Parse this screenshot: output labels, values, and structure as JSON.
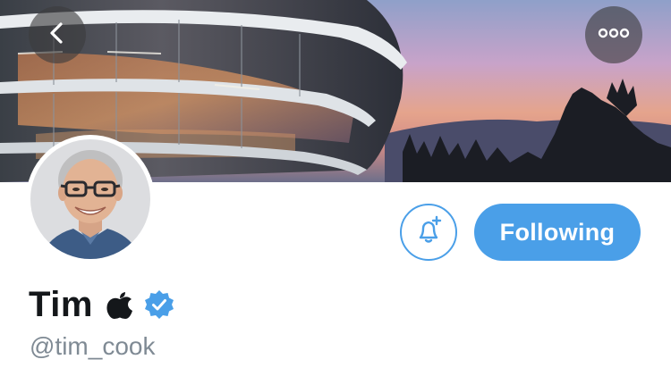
{
  "header": {
    "back_icon": "chevron-left-icon",
    "more_icon": "more-horizontal-icon",
    "banner_image": "apple-park-sunset-photo"
  },
  "profile": {
    "display_name": "Tim",
    "name_emoji": "apple-logo-icon",
    "verified_badge": "verified-checkmark-icon",
    "handle": "@tim_cook",
    "avatar": "profile-photo"
  },
  "actions": {
    "notifications_icon": "bell-plus-icon",
    "follow_label": "Following"
  },
  "colors": {
    "accent": "#4a9fe8",
    "text_primary": "#14171a",
    "text_secondary": "#7f8a94",
    "overlay_button": "#3c3c3e"
  }
}
